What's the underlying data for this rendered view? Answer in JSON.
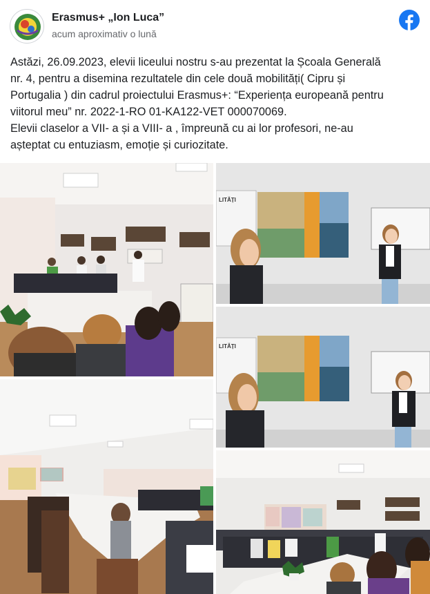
{
  "post": {
    "page_name": "Erasmus+ „Ion Luca”",
    "timestamp": "acum aproximativ o lună",
    "paragraph_lines": [
      "Astăzi, 26.09.2023, elevii liceului nostru s-au prezentat la Școala Generală",
      "nr. 4, pentru a disemina rezultatele din cele două mobilități( Cipru și",
      "Portugalia ) din cadrul proiectului Erasmus+: “Experiența europeană pentru",
      "viitorul meu” nr. 2022-1-RO 01-KA122-VET 000070069.",
      "Elevii claselor a VII- a și a VIII- a , împreună cu ai lor profesori, ne-au",
      "așteptat cu entuziasm, emoție și curiozitate."
    ]
  },
  "icons": {
    "facebook": "facebook-logo-icon",
    "avatar": "page-avatar"
  },
  "colors": {
    "facebook_blue": "#1877f2",
    "name_text": "#1c1e21",
    "meta_text": "#65676b"
  },
  "photos": {
    "board_text": "LITĂȚI"
  }
}
